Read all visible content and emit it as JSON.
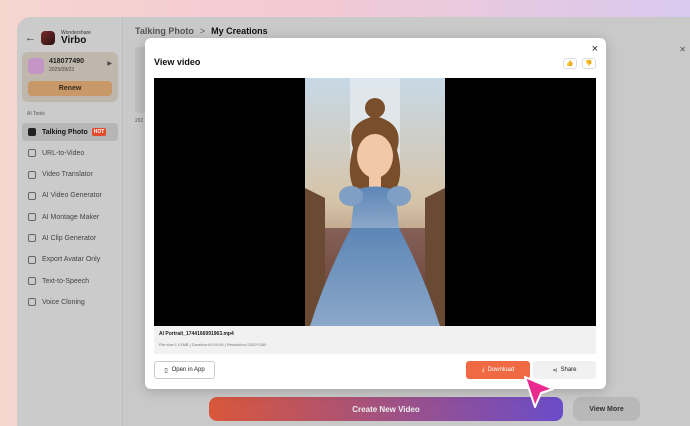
{
  "brand": {
    "small": "Wondershare",
    "name": "Virbo"
  },
  "account": {
    "id": "418077490",
    "date": "2025/09/23",
    "renew_label": "Renew"
  },
  "sidebar": {
    "section_label": "AI Tools",
    "items": [
      {
        "label": "Talking Photo",
        "badge": "HOT"
      },
      {
        "label": "URL-to-Video"
      },
      {
        "label": "Video Translator"
      },
      {
        "label": "AI Video Generator"
      },
      {
        "label": "AI Montage Maker"
      },
      {
        "label": "AI Clip Generator"
      },
      {
        "label": "Export Avatar Only"
      },
      {
        "label": "Text-to-Speech"
      },
      {
        "label": "Voice Cloning"
      }
    ]
  },
  "breadcrumb": {
    "parent": "Talking Photo",
    "separator": ">",
    "current": "My Creations"
  },
  "background": {
    "card_text": "202"
  },
  "modal": {
    "title": "View video",
    "close": "×",
    "file_name": "AI Portrait_1744166991963.mp4",
    "file_meta": "File size:1.01MB  |  Duration:00:00:08  |  Resolution:1352*1080",
    "open_in_app_label": "Open in App",
    "download_label": "Download",
    "share_label": "Share"
  },
  "footer": {
    "create_label": "Create New Video",
    "view_more_label": "View More"
  },
  "colors": {
    "accent_orange": "#ef6a43",
    "create_gradient_start": "#d9573a",
    "create_gradient_end": "#6a4cc9",
    "cursor_pink": "#ea2a8e"
  }
}
